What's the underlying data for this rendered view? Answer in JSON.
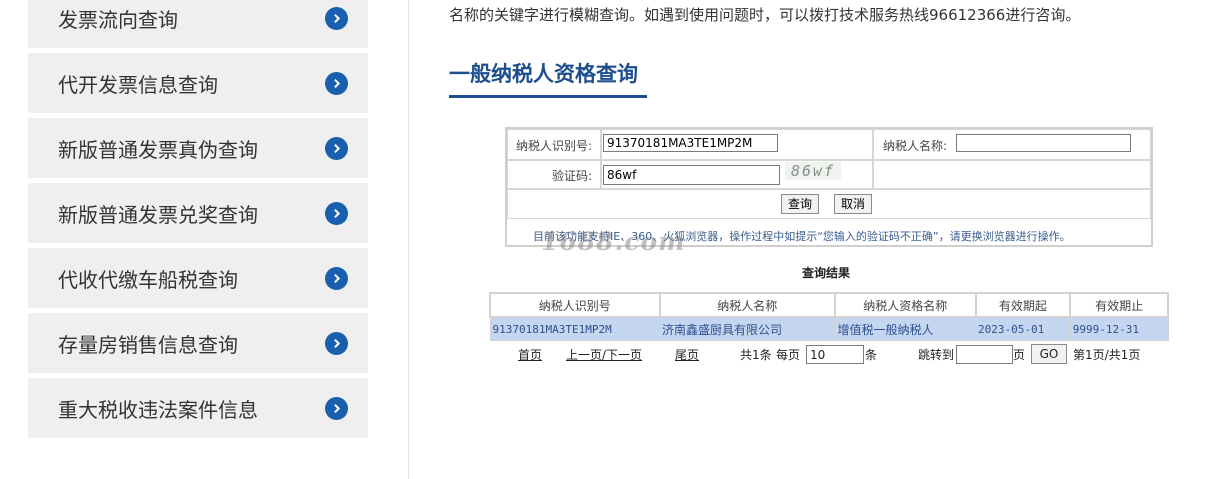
{
  "sidebar": {
    "items": [
      {
        "label": "发票流向查询"
      },
      {
        "label": "代开发票信息查询"
      },
      {
        "label": "新版普通发票真伪查询"
      },
      {
        "label": "新版普通发票兑奖查询"
      },
      {
        "label": "代收代缴车船税查询"
      },
      {
        "label": "存量房销售信息查询"
      },
      {
        "label": "重大税收违法案件信息"
      }
    ],
    "arrow_icon": "chevron-right-icon",
    "arrow_color": "#1a5fae"
  },
  "main": {
    "intro": "名称的关键字进行模糊查询。如遇到使用问题时，可以拨打技术服务热线96612366进行咨询。",
    "title": "一般纳税人资格查询"
  },
  "form": {
    "taxpayer_id_label": "纳税人识别号:",
    "taxpayer_id_value": "91370181MA3TE1MP2M",
    "taxpayer_name_label": "纳税人名称:",
    "taxpayer_name_value": "",
    "captcha_label": "验证码:",
    "captcha_value": "86wf",
    "captcha_image_text": "86wf",
    "query_button": "查询",
    "cancel_button": "取消",
    "note": "目前该功能支持IE、360、火狐浏览器，操作过程中如提示“您输入的验证码不正确”，请更换浏览器进行操作。"
  },
  "watermark": "1688.com",
  "results": {
    "title": "查询结果",
    "columns": [
      "纳税人识别号",
      "纳税人名称",
      "纳税人资格名称",
      "有效期起",
      "有效期止"
    ],
    "rows": [
      [
        "91370181MA3TE1MP2M",
        "济南鑫盛厨具有限公司",
        "增值税一般纳税人",
        "2023-05-01",
        "9999-12-31"
      ]
    ]
  },
  "pager": {
    "first": "首页",
    "prev_next": "上一页/下一页",
    "last": "尾页",
    "total": "共1条",
    "per_page_label": "每页",
    "per_page_value": "10",
    "per_page_unit": "条",
    "jump_label": "跳转到",
    "jump_value": "",
    "page_unit": "页",
    "go_button": "GO",
    "page_info": "第1页/共1页"
  }
}
